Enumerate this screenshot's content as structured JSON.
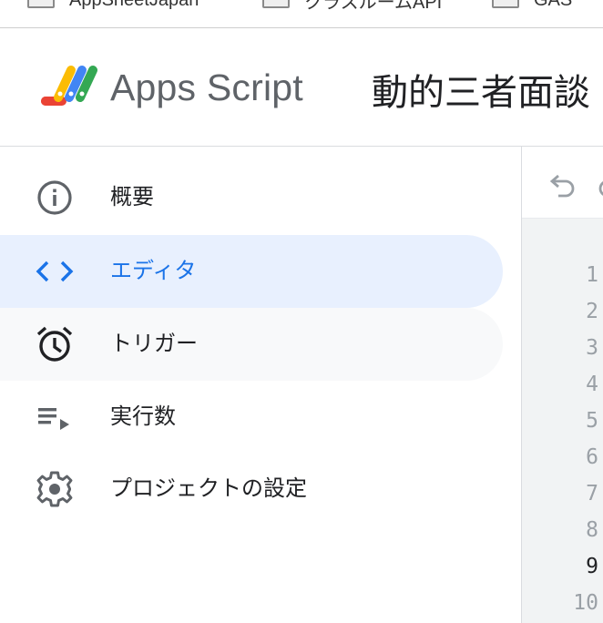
{
  "bookmarks": [
    {
      "label": "AppSheetJapan",
      "icon": "folder-icon"
    },
    {
      "label": "クラスルームAPI",
      "icon": "folder-icon"
    },
    {
      "label": "GAS",
      "icon": "folder-icon"
    }
  ],
  "header": {
    "app_name": "Apps Script",
    "project_title": "動的三者面談",
    "logo": "apps-script-logo"
  },
  "sidebar": {
    "items": [
      {
        "label": "概要",
        "icon": "info-icon",
        "state": "normal"
      },
      {
        "label": "エディタ",
        "icon": "code-icon",
        "state": "active"
      },
      {
        "label": "トリガー",
        "icon": "alarm-clock-icon",
        "state": "hover"
      },
      {
        "label": "実行数",
        "icon": "playlist-play-icon",
        "state": "normal"
      },
      {
        "label": "プロジェクトの設定",
        "icon": "gear-icon",
        "state": "normal"
      }
    ]
  },
  "editor": {
    "toolbar": [
      {
        "icon": "undo-icon"
      },
      {
        "icon": "redo-icon"
      }
    ],
    "line_numbers": [
      "1",
      "2",
      "3",
      "4",
      "5",
      "6",
      "7",
      "8",
      "9",
      "10"
    ],
    "current_line": "9"
  },
  "colors": {
    "accent": "#1a73e8",
    "active_bg": "#e8f0fe",
    "hover_bg": "#f8f9fa",
    "editor_bg": "#f1f3f4",
    "text": "#202124",
    "muted": "#5f6368"
  }
}
